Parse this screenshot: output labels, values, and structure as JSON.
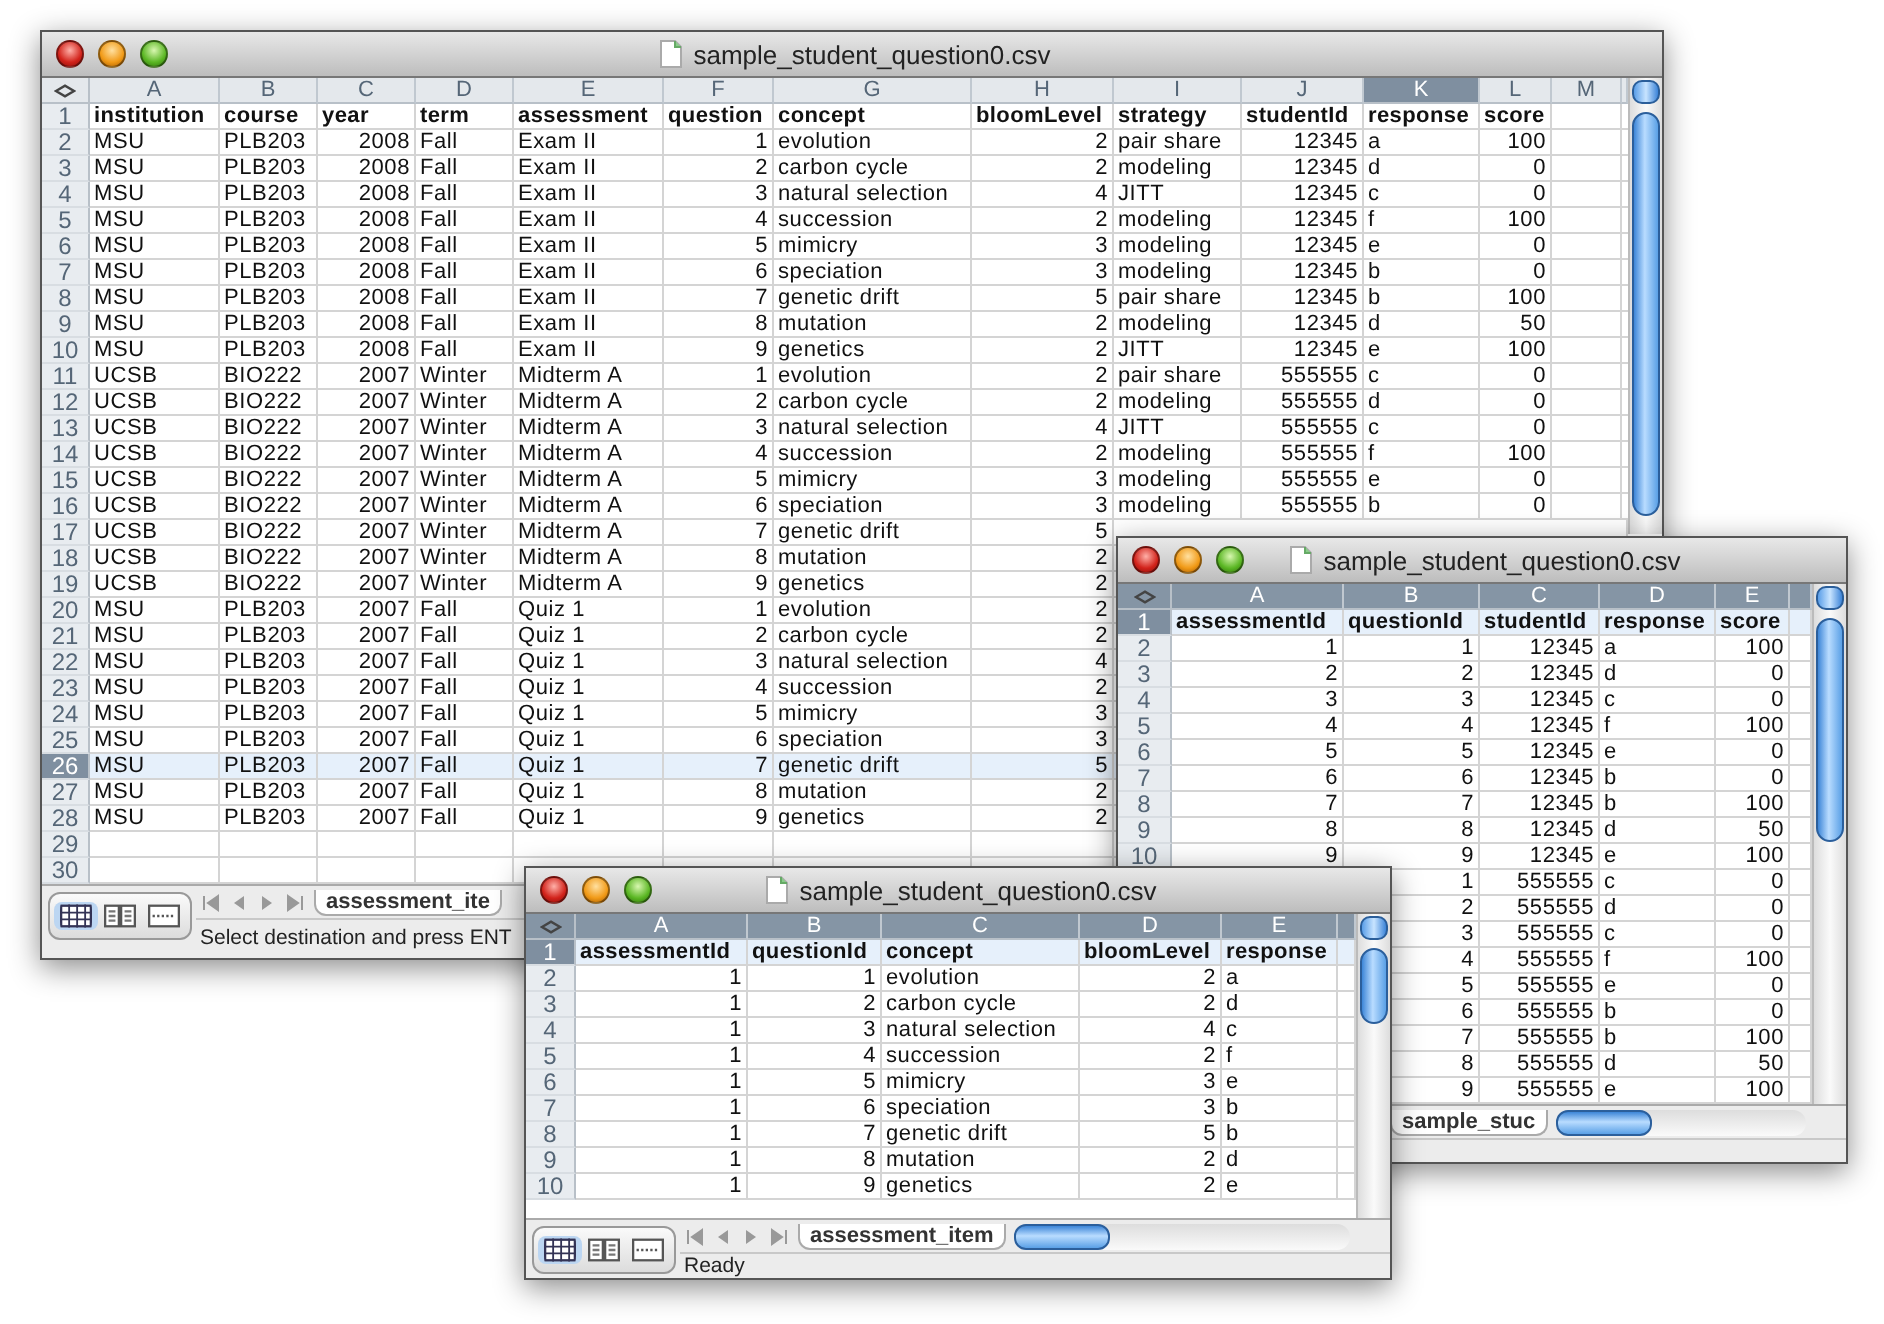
{
  "windows": [
    {
      "title": "sample_student_question0.csv",
      "columns": [
        {
          "label": "A",
          "selected": false
        },
        {
          "label": "B",
          "selected": false
        },
        {
          "label": "C",
          "selected": false
        },
        {
          "label": "D",
          "selected": false
        },
        {
          "label": "E",
          "selected": false
        },
        {
          "label": "F",
          "selected": false
        },
        {
          "label": "G",
          "selected": false
        },
        {
          "label": "H",
          "selected": false
        },
        {
          "label": "I",
          "selected": false
        },
        {
          "label": "J",
          "selected": false
        },
        {
          "label": "K",
          "selected": true
        },
        {
          "label": "L",
          "selected": false
        },
        {
          "label": "M",
          "selected": false
        }
      ],
      "rows": [
        {
          "n": "1",
          "selected": false,
          "cells": [
            "institution",
            "course",
            "year",
            "term",
            "assessment",
            "question",
            "concept",
            "bloomLevel",
            "strategy",
            "studentId",
            "response",
            "score"
          ]
        },
        {
          "n": "2",
          "selected": false,
          "cells": [
            "MSU",
            "PLB203",
            "2008",
            "Fall",
            "Exam II",
            "1",
            "evolution",
            "2",
            "pair share",
            "12345",
            "a",
            "100"
          ]
        },
        {
          "n": "3",
          "selected": false,
          "cells": [
            "MSU",
            "PLB203",
            "2008",
            "Fall",
            "Exam II",
            "2",
            "carbon cycle",
            "2",
            "modeling",
            "12345",
            "d",
            "0"
          ]
        },
        {
          "n": "4",
          "selected": false,
          "cells": [
            "MSU",
            "PLB203",
            "2008",
            "Fall",
            "Exam II",
            "3",
            "natural selection",
            "4",
            "JITT",
            "12345",
            "c",
            "0"
          ]
        },
        {
          "n": "5",
          "selected": false,
          "cells": [
            "MSU",
            "PLB203",
            "2008",
            "Fall",
            "Exam II",
            "4",
            "succession",
            "2",
            "modeling",
            "12345",
            "f",
            "100"
          ]
        },
        {
          "n": "6",
          "selected": false,
          "cells": [
            "MSU",
            "PLB203",
            "2008",
            "Fall",
            "Exam II",
            "5",
            "mimicry",
            "3",
            "modeling",
            "12345",
            "e",
            "0"
          ]
        },
        {
          "n": "7",
          "selected": false,
          "cells": [
            "MSU",
            "PLB203",
            "2008",
            "Fall",
            "Exam II",
            "6",
            "speciation",
            "3",
            "modeling",
            "12345",
            "b",
            "0"
          ]
        },
        {
          "n": "8",
          "selected": false,
          "cells": [
            "MSU",
            "PLB203",
            "2008",
            "Fall",
            "Exam II",
            "7",
            "genetic drift",
            "5",
            "pair share",
            "12345",
            "b",
            "100"
          ]
        },
        {
          "n": "9",
          "selected": false,
          "cells": [
            "MSU",
            "PLB203",
            "2008",
            "Fall",
            "Exam II",
            "8",
            "mutation",
            "2",
            "modeling",
            "12345",
            "d",
            "50"
          ]
        },
        {
          "n": "10",
          "selected": false,
          "cells": [
            "MSU",
            "PLB203",
            "2008",
            "Fall",
            "Exam II",
            "9",
            "genetics",
            "2",
            "JITT",
            "12345",
            "e",
            "100"
          ]
        },
        {
          "n": "11",
          "selected": false,
          "cells": [
            "UCSB",
            "BIO222",
            "2007",
            "Winter",
            "Midterm A",
            "1",
            "evolution",
            "2",
            "pair share",
            "555555",
            "c",
            "0"
          ]
        },
        {
          "n": "12",
          "selected": false,
          "cells": [
            "UCSB",
            "BIO222",
            "2007",
            "Winter",
            "Midterm A",
            "2",
            "carbon cycle",
            "2",
            "modeling",
            "555555",
            "d",
            "0"
          ]
        },
        {
          "n": "13",
          "selected": false,
          "cells": [
            "UCSB",
            "BIO222",
            "2007",
            "Winter",
            "Midterm A",
            "3",
            "natural selection",
            "4",
            "JITT",
            "555555",
            "c",
            "0"
          ]
        },
        {
          "n": "14",
          "selected": false,
          "cells": [
            "UCSB",
            "BIO222",
            "2007",
            "Winter",
            "Midterm A",
            "4",
            "succession",
            "2",
            "modeling",
            "555555",
            "f",
            "100"
          ]
        },
        {
          "n": "15",
          "selected": false,
          "cells": [
            "UCSB",
            "BIO222",
            "2007",
            "Winter",
            "Midterm A",
            "5",
            "mimicry",
            "3",
            "modeling",
            "555555",
            "e",
            "0"
          ]
        },
        {
          "n": "16",
          "selected": false,
          "cells": [
            "UCSB",
            "BIO222",
            "2007",
            "Winter",
            "Midterm A",
            "6",
            "speciation",
            "3",
            "modeling",
            "555555",
            "b",
            "0"
          ]
        },
        {
          "n": "17",
          "selected": false,
          "cells": [
            "UCSB",
            "BIO222",
            "2007",
            "Winter",
            "Midterm A",
            "7",
            "genetic drift",
            "5"
          ]
        },
        {
          "n": "18",
          "selected": false,
          "cells": [
            "UCSB",
            "BIO222",
            "2007",
            "Winter",
            "Midterm A",
            "8",
            "mutation",
            "2"
          ]
        },
        {
          "n": "19",
          "selected": false,
          "cells": [
            "UCSB",
            "BIO222",
            "2007",
            "Winter",
            "Midterm A",
            "9",
            "genetics",
            "2"
          ]
        },
        {
          "n": "20",
          "selected": false,
          "cells": [
            "MSU",
            "PLB203",
            "2007",
            "Fall",
            "Quiz 1",
            "1",
            "evolution",
            "2"
          ]
        },
        {
          "n": "21",
          "selected": false,
          "cells": [
            "MSU",
            "PLB203",
            "2007",
            "Fall",
            "Quiz 1",
            "2",
            "carbon cycle",
            "2"
          ]
        },
        {
          "n": "22",
          "selected": false,
          "cells": [
            "MSU",
            "PLB203",
            "2007",
            "Fall",
            "Quiz 1",
            "3",
            "natural selection",
            "4"
          ]
        },
        {
          "n": "23",
          "selected": false,
          "cells": [
            "MSU",
            "PLB203",
            "2007",
            "Fall",
            "Quiz 1",
            "4",
            "succession",
            "2"
          ]
        },
        {
          "n": "24",
          "selected": false,
          "cells": [
            "MSU",
            "PLB203",
            "2007",
            "Fall",
            "Quiz 1",
            "5",
            "mimicry",
            "3"
          ]
        },
        {
          "n": "25",
          "selected": false,
          "cells": [
            "MSU",
            "PLB203",
            "2007",
            "Fall",
            "Quiz 1",
            "6",
            "speciation",
            "3"
          ]
        },
        {
          "n": "26",
          "selected": true,
          "cells": [
            "MSU",
            "PLB203",
            "2007",
            "Fall",
            "Quiz 1",
            "7",
            "genetic drift",
            "5"
          ]
        },
        {
          "n": "27",
          "selected": false,
          "cells": [
            "MSU",
            "PLB203",
            "2007",
            "Fall",
            "Quiz 1",
            "8",
            "mutation",
            "2"
          ]
        },
        {
          "n": "28",
          "selected": false,
          "cells": [
            "MSU",
            "PLB203",
            "2007",
            "Fall",
            "Quiz 1",
            "9",
            "genetics",
            "2"
          ]
        },
        {
          "n": "29",
          "selected": false,
          "cells": []
        },
        {
          "n": "30",
          "selected": false,
          "cells": []
        }
      ],
      "sheet_tab": {
        "label": "assessment_ite",
        "selected": true
      },
      "status": "Select destination and press ENT"
    },
    {
      "title": "sample_student_question0.csv",
      "columns": [
        {
          "label": "A",
          "selected": false
        },
        {
          "label": "B",
          "selected": false
        },
        {
          "label": "C",
          "selected": false
        },
        {
          "label": "D",
          "selected": false
        },
        {
          "label": "E",
          "selected": false
        }
      ],
      "rows": [
        {
          "n": "1",
          "selected": true,
          "cells": [
            "assessmentId",
            "questionId",
            "studentId",
            "response",
            "score"
          ]
        },
        {
          "n": "2",
          "selected": false,
          "cells": [
            "1",
            "1",
            "12345",
            "a",
            "100"
          ]
        },
        {
          "n": "3",
          "selected": false,
          "cells": [
            "2",
            "2",
            "12345",
            "d",
            "0"
          ]
        },
        {
          "n": "4",
          "selected": false,
          "cells": [
            "3",
            "3",
            "12345",
            "c",
            "0"
          ]
        },
        {
          "n": "5",
          "selected": false,
          "cells": [
            "4",
            "4",
            "12345",
            "f",
            "100"
          ]
        },
        {
          "n": "6",
          "selected": false,
          "cells": [
            "5",
            "5",
            "12345",
            "e",
            "0"
          ]
        },
        {
          "n": "7",
          "selected": false,
          "cells": [
            "6",
            "6",
            "12345",
            "b",
            "0"
          ]
        },
        {
          "n": "8",
          "selected": false,
          "cells": [
            "7",
            "7",
            "12345",
            "b",
            "100"
          ]
        },
        {
          "n": "9",
          "selected": false,
          "cells": [
            "8",
            "8",
            "12345",
            "d",
            "50"
          ]
        },
        {
          "n": "10",
          "selected": false,
          "cells": [
            "9",
            "9",
            "12345",
            "e",
            "100"
          ]
        },
        {
          "cells": [
            "1",
            "555555",
            "c",
            "0"
          ]
        },
        {
          "cells": [
            "2",
            "555555",
            "d",
            "0"
          ]
        },
        {
          "cells": [
            "3",
            "555555",
            "c",
            "0"
          ]
        },
        {
          "cells": [
            "4",
            "555555",
            "f",
            "100"
          ]
        },
        {
          "cells": [
            "5",
            "555555",
            "e",
            "0"
          ]
        },
        {
          "cells": [
            "6",
            "555555",
            "b",
            "0"
          ]
        },
        {
          "cells": [
            "7",
            "555555",
            "b",
            "100"
          ]
        },
        {
          "cells": [
            "8",
            "555555",
            "d",
            "50"
          ]
        },
        {
          "cells": [
            "9",
            "555555",
            "e",
            "100"
          ]
        }
      ],
      "sheet_tab": {
        "label": "sample_stuc",
        "selected": true
      }
    },
    {
      "title": "sample_student_question0.csv",
      "columns": [
        {
          "label": "A",
          "selected": false
        },
        {
          "label": "B",
          "selected": false
        },
        {
          "label": "C",
          "selected": false
        },
        {
          "label": "D",
          "selected": false
        },
        {
          "label": "E",
          "selected": false
        }
      ],
      "rows": [
        {
          "n": "1",
          "selected": true,
          "cells": [
            "assessmentId",
            "questionId",
            "concept",
            "bloomLevel",
            "response"
          ]
        },
        {
          "n": "2",
          "selected": false,
          "cells": [
            "1",
            "1",
            "evolution",
            "2",
            "a"
          ]
        },
        {
          "n": "3",
          "selected": false,
          "cells": [
            "1",
            "2",
            "carbon cycle",
            "2",
            "d"
          ]
        },
        {
          "n": "4",
          "selected": false,
          "cells": [
            "1",
            "3",
            "natural selection",
            "4",
            "c"
          ]
        },
        {
          "n": "5",
          "selected": false,
          "cells": [
            "1",
            "4",
            "succession",
            "2",
            "f"
          ]
        },
        {
          "n": "6",
          "selected": false,
          "cells": [
            "1",
            "5",
            "mimicry",
            "3",
            "e"
          ]
        },
        {
          "n": "7",
          "selected": false,
          "cells": [
            "1",
            "6",
            "speciation",
            "3",
            "b"
          ]
        },
        {
          "n": "8",
          "selected": false,
          "cells": [
            "1",
            "7",
            "genetic drift",
            "5",
            "b"
          ]
        },
        {
          "n": "9",
          "selected": false,
          "cells": [
            "1",
            "8",
            "mutation",
            "2",
            "d"
          ]
        },
        {
          "n": "10",
          "selected": false,
          "cells": [
            "1",
            "9",
            "genetics",
            "2",
            "e"
          ]
        }
      ],
      "sheet_tab": {
        "label": "assessment_item",
        "selected": true
      },
      "status": "Ready"
    }
  ]
}
